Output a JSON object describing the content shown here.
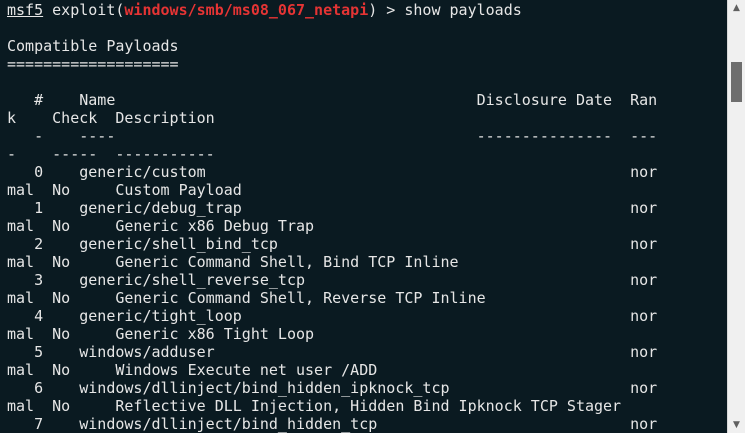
{
  "prompt": {
    "app": "msf5",
    "command_prefix": " exploit(",
    "module": "windows/smb/ms08_067_netapi",
    "command_suffix": ") > show payloads"
  },
  "output": {
    "title": "Compatible Payloads",
    "title_underline": "===================",
    "header_line_1": "   #    Name                                        Disclosure Date  Ran",
    "header_line_2": "k    Check  Description",
    "divider_line_1": "   -    ----                                        ---------------  ---",
    "divider_line_2": "-    -----  -----------",
    "rows": [
      {
        "line1": "   0    generic/custom                                               nor",
        "line2": "mal  No     Custom Payload"
      },
      {
        "line1": "   1    generic/debug_trap                                           nor",
        "line2": "mal  No     Generic x86 Debug Trap"
      },
      {
        "line1": "   2    generic/shell_bind_tcp                                       nor",
        "line2": "mal  No     Generic Command Shell, Bind TCP Inline"
      },
      {
        "line1": "   3    generic/shell_reverse_tcp                                    nor",
        "line2": "mal  No     Generic Command Shell, Reverse TCP Inline"
      },
      {
        "line1": "   4    generic/tight_loop                                           nor",
        "line2": "mal  No     Generic x86 Tight Loop"
      },
      {
        "line1": "   5    windows/adduser                                              nor",
        "line2": "mal  No     Windows Execute net user /ADD"
      },
      {
        "line1": "   6    windows/dllinject/bind_hidden_ipknock_tcp                    nor",
        "line2": "mal  No     Reflective DLL Injection, Hidden Bind Ipknock TCP Stager"
      },
      {
        "line1": "   7    windows/dllinject/bind_hidden_tcp                            nor",
        "line2": ""
      }
    ]
  },
  "scrollbar": {
    "up_icon": "▲",
    "down_icon": "▼",
    "position": 0.14
  },
  "colors": {
    "background": "#0a1a21",
    "text": "#e6e6e6",
    "module": "#e53434"
  }
}
